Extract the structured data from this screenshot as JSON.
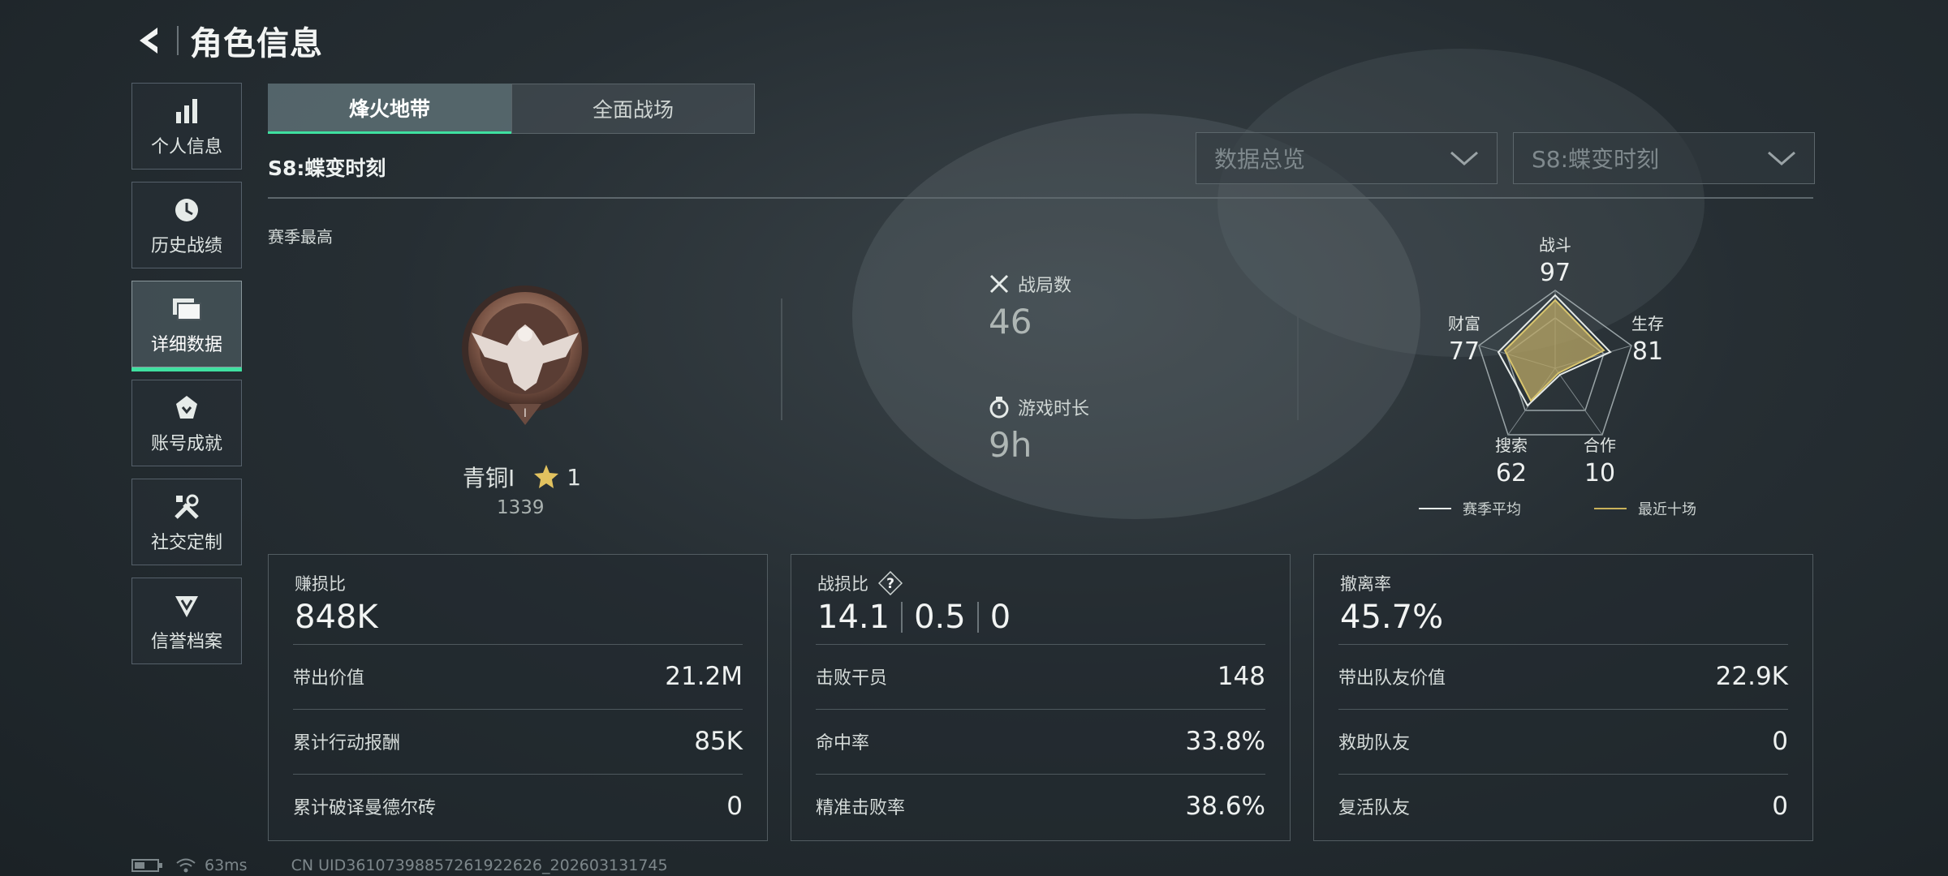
{
  "header": {
    "title": "角色信息"
  },
  "sidebar": {
    "items": [
      {
        "label": "个人信息",
        "icon": "bar-chart-icon"
      },
      {
        "label": "历史战绩",
        "icon": "clock-icon"
      },
      {
        "label": "详细数据",
        "icon": "folder-icon",
        "active": true
      },
      {
        "label": "账号成就",
        "icon": "badge-icon"
      },
      {
        "label": "社交定制",
        "icon": "tools-icon"
      },
      {
        "label": "信誉档案",
        "icon": "emblem-icon"
      }
    ]
  },
  "tabs": [
    {
      "label": "烽火地带",
      "active": true
    },
    {
      "label": "全面战场",
      "active": false
    }
  ],
  "season": {
    "label": "S8:蝶变时刻"
  },
  "dropdowns": {
    "category": {
      "value": "数据总览"
    },
    "season": {
      "value": "S8:蝶变时刻"
    }
  },
  "overview": {
    "season_best_label": "赛季最高",
    "rank": {
      "name": "青铜Ⅰ",
      "stars": "1",
      "score": "1339"
    },
    "matches": {
      "label": "战局数",
      "value": "46"
    },
    "playtime": {
      "label": "游戏时长",
      "value": "9h"
    }
  },
  "radar": {
    "axes": [
      {
        "label": "战斗",
        "value": "97"
      },
      {
        "label": "生存",
        "value": "81"
      },
      {
        "label": "合作",
        "value": "10"
      },
      {
        "label": "搜索",
        "value": "62"
      },
      {
        "label": "财富",
        "value": "77"
      }
    ],
    "legend": [
      {
        "label": "赛季平均",
        "color": "#e6ebe9"
      },
      {
        "label": "最近十场",
        "color": "#c9b25a"
      }
    ]
  },
  "cards": {
    "profit": {
      "title": "赚损比",
      "value": "848K",
      "rows": [
        {
          "label": "带出价值",
          "value": "21.2M"
        },
        {
          "label": "累计行动报酬",
          "value": "85K"
        },
        {
          "label": "累计破译曼德尔砖",
          "value": "0"
        }
      ]
    },
    "combat": {
      "title": "战损比",
      "values": [
        "14.1",
        "0.5",
        "0"
      ],
      "help": "?",
      "rows": [
        {
          "label": "击败干员",
          "value": "148"
        },
        {
          "label": "命中率",
          "value": "33.8%"
        },
        {
          "label": "精准击败率",
          "value": "38.6%"
        }
      ]
    },
    "extract": {
      "title": "撤离率",
      "value": "45.7%",
      "rows": [
        {
          "label": "带出队友价值",
          "value": "22.9K"
        },
        {
          "label": "救助队友",
          "value": "0"
        },
        {
          "label": "复活队友",
          "value": "0"
        }
      ]
    }
  },
  "status": {
    "ping": "63ms",
    "uid": "CN UID3610739885726192262​6_202603131745"
  }
}
